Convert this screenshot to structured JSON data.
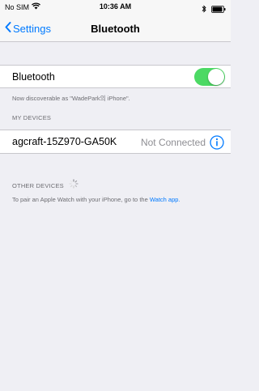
{
  "status_bar": {
    "carrier": "No SIM",
    "time": "10:36 AM",
    "icons": [
      "wifi-icon",
      "bluetooth-icon",
      "battery-icon"
    ]
  },
  "nav": {
    "back_label": "Settings",
    "title": "Bluetooth"
  },
  "bluetooth": {
    "label": "Bluetooth",
    "enabled": true,
    "discoverable_text": "Now discoverable as \"WadePark의 iPhone\"."
  },
  "my_devices": {
    "header": "MY DEVICES",
    "devices": [
      {
        "name": "agcraft-15Z970-GA50K",
        "status": "Not Connected"
      }
    ]
  },
  "other_devices": {
    "header": "OTHER DEVICES",
    "pair_text": "To pair an Apple Watch with your iPhone, go to the",
    "link_text": "Watch app."
  },
  "colors": {
    "accent": "#007aff",
    "toggle_on": "#4cd964",
    "background": "#efeff4",
    "secondary_text": "#6d6d72"
  }
}
